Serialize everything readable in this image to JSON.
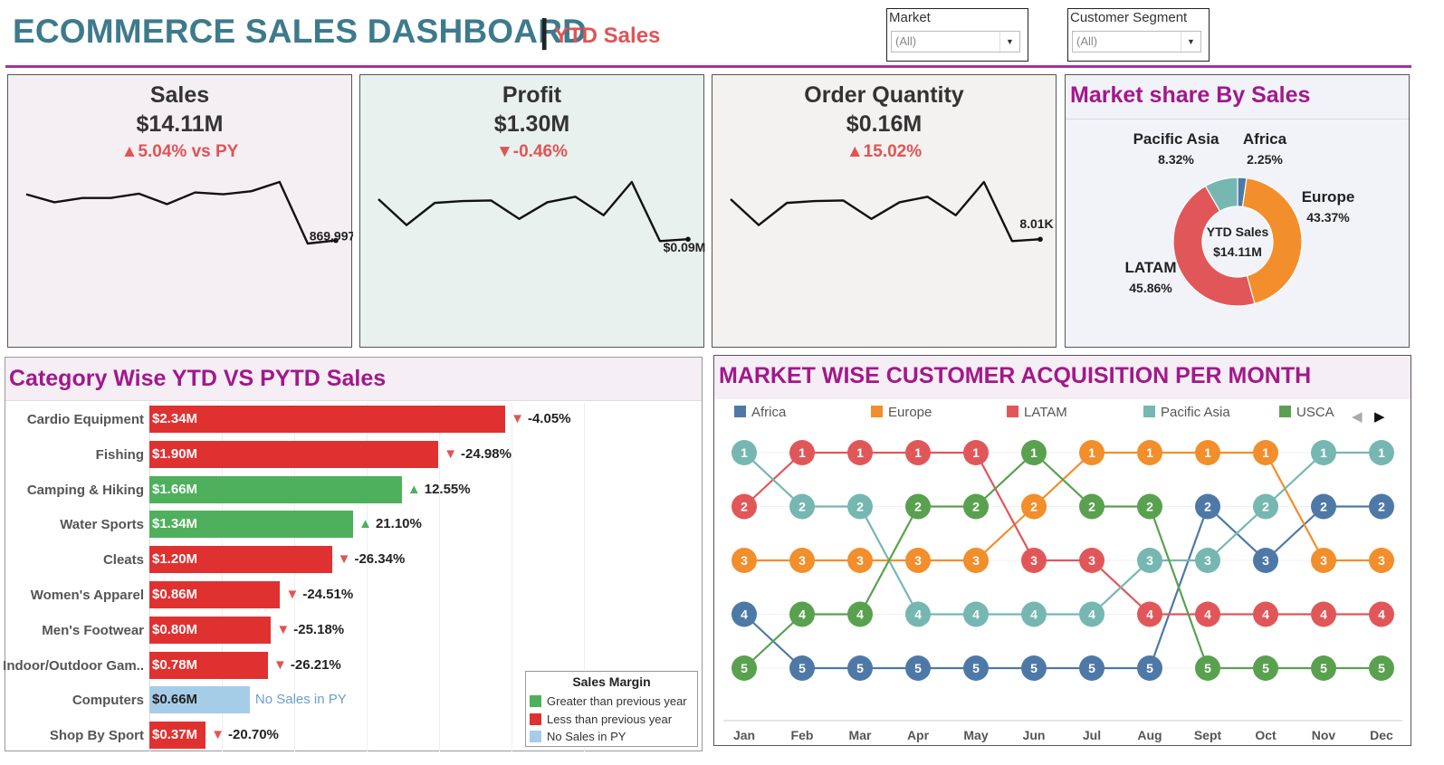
{
  "header": {
    "title": "ECOMMERCE SALES DASHBOARD",
    "separator": "|",
    "subtitle": "YTD Sales"
  },
  "filters": [
    {
      "label": "Market",
      "value": "(All)"
    },
    {
      "label": "Customer Segment",
      "value": "(All)"
    }
  ],
  "kpis": [
    {
      "name": "Sales",
      "value": "$14.11M",
      "delta": "▲5.04% vs PY",
      "end_label": "869,997",
      "bg": "#f4eff3",
      "spark": [
        0.2,
        0.33,
        0.26,
        0.26,
        0.19,
        0.36,
        0.17,
        0.2,
        0.15,
        0.0,
        1.0,
        0.95
      ]
    },
    {
      "name": "Profit",
      "value": "$1.30M",
      "delta": "▼-0.46%",
      "end_label": "$0.09M",
      "bg": "#e9f1ef",
      "spark": [
        0.28,
        0.7,
        0.34,
        0.31,
        0.3,
        0.6,
        0.33,
        0.24,
        0.54,
        0.0,
        0.96,
        0.93
      ]
    },
    {
      "name": "Order Quantity",
      "value": "$0.16M",
      "delta": "▲15.02%",
      "end_label": "8.01K",
      "bg": "#f4f1f1",
      "spark": [
        0.28,
        0.7,
        0.34,
        0.31,
        0.3,
        0.6,
        0.33,
        0.24,
        0.54,
        0.0,
        0.96,
        0.93
      ]
    }
  ],
  "market_share": {
    "title": "Market share By Sales",
    "center_label": "YTD Sales",
    "center_value": "$14.11M"
  },
  "category_panel": {
    "title": "Category Wise YTD VS PYTD Sales",
    "legend_title": "Sales Margin",
    "legend": [
      {
        "label": "Greater than previous year",
        "color": "#4eb05c"
      },
      {
        "label": "Less than previous year",
        "color": "#e03131"
      },
      {
        "label": "No Sales in PY",
        "color": "#a6cde8"
      }
    ]
  },
  "acq_panel": {
    "title": "MARKET WISE CUSTOMER ACQUISITION PER MONTH"
  },
  "chart_data": [
    {
      "type": "pie",
      "title": "Market share By Sales",
      "slices": [
        {
          "name": "Africa",
          "value": 2.25,
          "label": "2.25%",
          "color": "#4e79a7"
        },
        {
          "name": "Europe",
          "value": 43.37,
          "label": "43.37%",
          "color": "#f28e2b"
        },
        {
          "name": "LATAM",
          "value": 45.86,
          "label": "45.86%",
          "color": "#e15759"
        },
        {
          "name": "Pacific Asia",
          "value": 8.32,
          "label": "8.32%",
          "color": "#76b7b2"
        }
      ]
    },
    {
      "type": "bar",
      "title": "Category Wise YTD VS PYTD Sales",
      "categories": [
        "Cardio Equipment",
        "Fishing",
        "Camping & Hiking",
        "Water Sports",
        "Cleats",
        "Women's Apparel",
        "Men's Footwear",
        "Indoor/Outdoor Gam..",
        "Computers",
        "Shop By Sport"
      ],
      "values": [
        2.34,
        1.9,
        1.66,
        1.34,
        1.2,
        0.86,
        0.8,
        0.78,
        0.66,
        0.37
      ],
      "value_labels": [
        "$2.34M",
        "$1.90M",
        "$1.66M",
        "$1.34M",
        "$1.20M",
        "$0.86M",
        "$0.80M",
        "$0.78M",
        "$0.66M",
        "$0.37M"
      ],
      "change_labels": [
        "-4.05%",
        "-24.98%",
        "12.55%",
        "21.10%",
        "-26.34%",
        "-24.51%",
        "-25.18%",
        "-26.21%",
        "No Sales in PY",
        "-20.70%"
      ],
      "status": [
        "down",
        "down",
        "up",
        "up",
        "down",
        "down",
        "down",
        "down",
        "none",
        "down"
      ],
      "xlim": [
        0,
        2.9
      ]
    },
    {
      "type": "line",
      "title": "MARKET WISE CUSTOMER ACQUISITION PER MONTH",
      "x": [
        "Jan",
        "Feb",
        "Mar",
        "Apr",
        "May",
        "Jun",
        "Jul",
        "Aug",
        "Sept",
        "Oct",
        "Nov",
        "Dec"
      ],
      "ylim": [
        1,
        5
      ],
      "series": [
        {
          "name": "Africa",
          "color": "#4e79a7",
          "values": [
            4,
            5,
            5,
            5,
            5,
            5,
            5,
            5,
            2,
            3,
            2,
            2
          ]
        },
        {
          "name": "Europe",
          "color": "#f28e2b",
          "values": [
            3,
            3,
            3,
            3,
            3,
            2,
            1,
            1,
            1,
            1,
            3,
            3
          ]
        },
        {
          "name": "LATAM",
          "color": "#e15759",
          "values": [
            2,
            1,
            1,
            1,
            1,
            3,
            3,
            4,
            4,
            4,
            4,
            4
          ]
        },
        {
          "name": "Pacific Asia",
          "color": "#76b7b2",
          "values": [
            1,
            2,
            2,
            4,
            4,
            4,
            4,
            3,
            3,
            2,
            1,
            1
          ]
        },
        {
          "name": "USCA",
          "color": "#59a14f",
          "values": [
            5,
            4,
            4,
            2,
            2,
            1,
            2,
            2,
            5,
            5,
            5,
            5
          ]
        }
      ]
    }
  ]
}
